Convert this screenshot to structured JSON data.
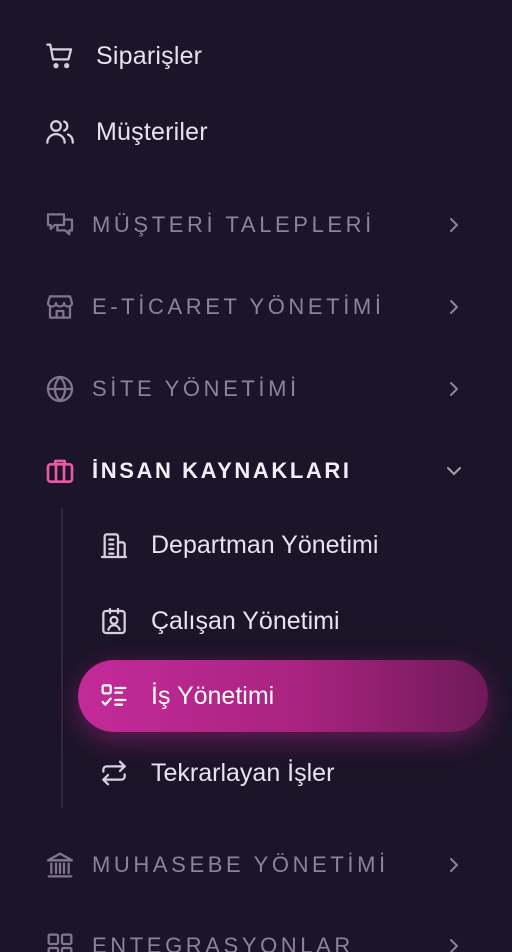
{
  "top_items": [
    {
      "label": "Siparişler",
      "icon": "shopping-cart-icon"
    },
    {
      "label": "Müşteriler",
      "icon": "users-icon"
    }
  ],
  "sections": [
    {
      "label": "MÜŞTERİ TALEPLERİ",
      "icon": "messages-icon",
      "expanded": false
    },
    {
      "label": "E-TİCARET YÖNETİMİ",
      "icon": "store-icon",
      "expanded": false
    },
    {
      "label": "SİTE YÖNETİMİ",
      "icon": "globe-icon",
      "expanded": false
    },
    {
      "label": "İNSAN KAYNAKLARI",
      "icon": "briefcase-icon",
      "expanded": true
    },
    {
      "label": "MUHASEBE YÖNETİMİ",
      "icon": "bank-icon",
      "expanded": false
    },
    {
      "label": "ENTEGRASYONLAR",
      "icon": "apps-icon",
      "expanded": false
    }
  ],
  "hr_subitems": [
    {
      "label": "Departman Yönetimi",
      "icon": "building-icon",
      "active": false
    },
    {
      "label": "Çalışan Yönetimi",
      "icon": "id-badge-icon",
      "active": false
    },
    {
      "label": "İş Yönetimi",
      "icon": "task-list-icon",
      "active": true
    },
    {
      "label": "Tekrarlayan İşler",
      "icon": "repeat-icon",
      "active": false
    }
  ],
  "colors": {
    "background": "#1c1428",
    "accent_start": "#c42a9a",
    "accent_end": "#6e1a58",
    "active_section_icon": "#e85aa8"
  }
}
